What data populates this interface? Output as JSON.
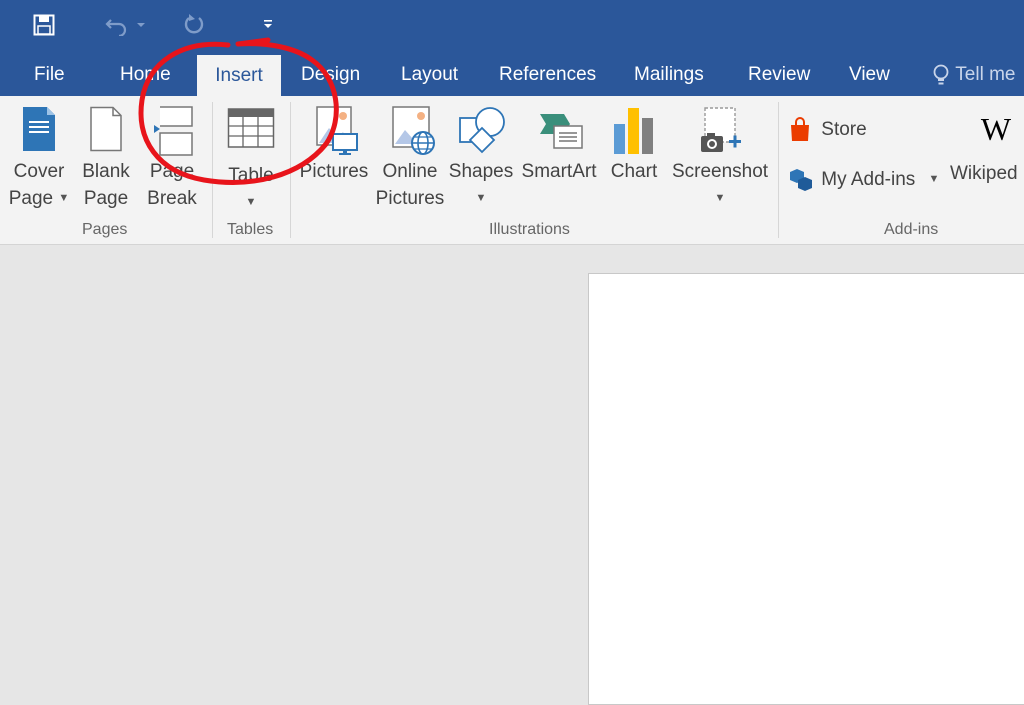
{
  "tabs": [
    {
      "label": "File"
    },
    {
      "label": "Home"
    },
    {
      "label": "Insert",
      "active": true
    },
    {
      "label": "Design"
    },
    {
      "label": "Layout"
    },
    {
      "label": "References"
    },
    {
      "label": "Mailings"
    },
    {
      "label": "Review"
    },
    {
      "label": "View"
    }
  ],
  "tell_me": {
    "text": "Tell me"
  },
  "ribbon": {
    "pages": {
      "group_label": "Pages",
      "cover_page": {
        "line1": "Cover",
        "line2": "Page"
      },
      "blank_page": {
        "line1": "Blank",
        "line2": "Page"
      },
      "page_break": {
        "line1": "Page",
        "line2": "Break"
      }
    },
    "tables": {
      "group_label": "Tables",
      "table": {
        "label": "Table"
      }
    },
    "illustrations": {
      "group_label": "Illustrations",
      "pictures": {
        "label": "Pictures"
      },
      "online_pictures": {
        "line1": "Online",
        "line2": "Pictures"
      },
      "shapes": {
        "label": "Shapes"
      },
      "smartart": {
        "label": "SmartArt"
      },
      "chart": {
        "label": "Chart"
      },
      "screenshot": {
        "label": "Screenshot"
      }
    },
    "addins": {
      "group_label": "Add-ins",
      "store": {
        "label": "Store"
      },
      "my_addins": {
        "label": "My Add-ins"
      },
      "wikipedia": {
        "label": "Wikiped"
      }
    }
  },
  "colors": {
    "title_bar": "#2b579a",
    "active_tab_text": "#2b579a",
    "ribbon_bg": "#f3f3f3",
    "annotation": "#e8141b"
  }
}
